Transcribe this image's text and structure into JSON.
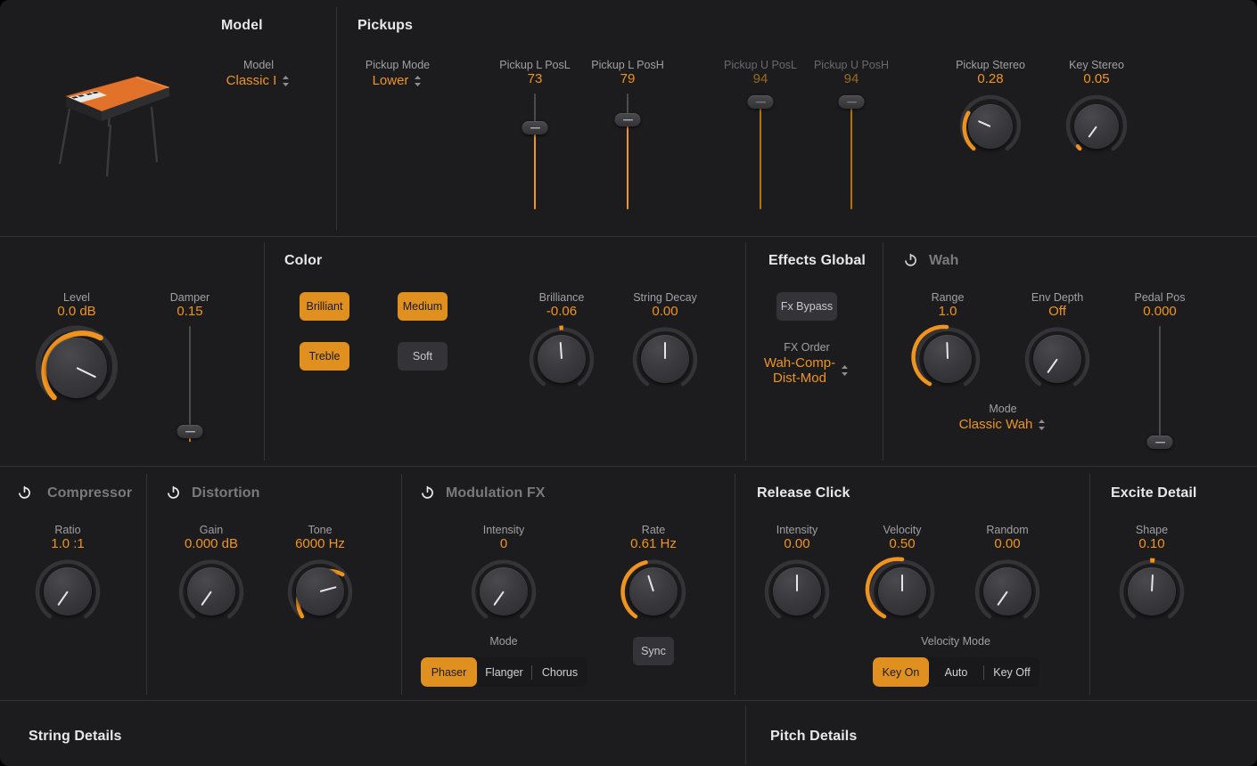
{
  "sections": {
    "model": {
      "title": "Model"
    },
    "pickups": {
      "title": "Pickups"
    },
    "color": {
      "title": "Color"
    },
    "effects_global": {
      "title": "Effects Global"
    },
    "wah": {
      "title": "Wah",
      "power_icon": "power-icon",
      "enabled": false
    },
    "compressor": {
      "title": "Compressor",
      "power_icon": "power-icon",
      "enabled": false
    },
    "distortion": {
      "title": "Distortion",
      "power_icon": "power-icon",
      "enabled": false
    },
    "modulation_fx": {
      "title": "Modulation FX",
      "power_icon": "power-icon",
      "enabled": false
    },
    "release_click": {
      "title": "Release Click"
    },
    "excite_detail": {
      "title": "Excite Detail"
    },
    "string_details": {
      "title": "String Details"
    },
    "pitch_details": {
      "title": "Pitch Details"
    }
  },
  "instrument_image": {
    "name": "electric-piano-illustration"
  },
  "model": {
    "label": "Model",
    "value": "Classic I",
    "chevron_icon": "chevron-up-down-icon"
  },
  "pickup_mode": {
    "label": "Pickup Mode",
    "value": "Lower",
    "chevron_icon": "chevron-up-down-icon"
  },
  "pickup_sliders": [
    {
      "label": "Pickup L PosL",
      "value": "73",
      "enabled": true,
      "pos": 0.27
    },
    {
      "label": "Pickup L PosH",
      "value": "79",
      "enabled": true,
      "pos": 0.21
    },
    {
      "label": "Pickup U PosL",
      "value": "94",
      "enabled": false,
      "pos": 0.06
    },
    {
      "label": "Pickup U PosH",
      "value": "94",
      "enabled": false,
      "pos": 0.06
    }
  ],
  "pickup_stereo": {
    "label": "Pickup Stereo",
    "value": "0.28",
    "arc": 0.28
  },
  "key_stereo": {
    "label": "Key Stereo",
    "value": "0.05",
    "arc": 0.05
  },
  "level": {
    "label": "Level",
    "value": "0.0 dB",
    "arc": 0.8
  },
  "damper": {
    "label": "Damper",
    "value": "0.15",
    "pos": 0.86
  },
  "color_buttons": [
    {
      "label": "Brilliant",
      "active": true
    },
    {
      "label": "Medium",
      "active": true
    },
    {
      "label": "Treble",
      "active": true
    },
    {
      "label": "Soft",
      "active": false
    }
  ],
  "brilliance": {
    "label": "Brilliance",
    "value": "-0.06",
    "arc": 0.47,
    "bipolar": true
  },
  "string_decay": {
    "label": "String Decay",
    "value": "0.00",
    "arc": 0.5,
    "bipolar": true
  },
  "fx_bypass": {
    "label": "Fx Bypass",
    "active": false
  },
  "fx_order": {
    "label": "FX Order",
    "value_line1": "Wah-Comp-",
    "value_line2": "Dist-Mod",
    "chevron_icon": "chevron-up-down-icon"
  },
  "wah_range": {
    "label": "Range",
    "value": "1.0",
    "arc": 1.0
  },
  "wah_env_depth": {
    "label": "Env Depth",
    "value": "Off",
    "arc": 0.0
  },
  "wah_pedal_pos": {
    "label": "Pedal Pos",
    "value": "0.000",
    "pos": 1.0
  },
  "wah_mode": {
    "label": "Mode",
    "value": "Classic Wah",
    "chevron_icon": "chevron-up-down-icon"
  },
  "comp_ratio": {
    "label": "Ratio",
    "value": "1.0 :1",
    "arc": 0.0
  },
  "dist_gain": {
    "label": "Gain",
    "value": "0.000 dB",
    "arc": 0.0
  },
  "dist_tone": {
    "label": "Tone",
    "value": "6000 Hz",
    "arc": 0.72
  },
  "mod_intensity": {
    "label": "Intensity",
    "value": "0",
    "arc": 0.0
  },
  "mod_rate": {
    "label": "Rate",
    "value": "0.61 Hz",
    "arc": 0.6
  },
  "mod_mode": {
    "label": "Mode",
    "options": [
      "Phaser",
      "Flanger",
      "Chorus"
    ],
    "selected": "Phaser"
  },
  "sync_button": {
    "label": "Sync",
    "active": false
  },
  "rc_intensity": {
    "label": "Intensity",
    "value": "0.00",
    "arc": 0.5,
    "bipolar": true
  },
  "rc_velocity": {
    "label": "Velocity",
    "value": "0.50",
    "arc": 0.5,
    "bipolar": true
  },
  "rc_random": {
    "label": "Random",
    "value": "0.00",
    "arc": 0.0
  },
  "velocity_mode": {
    "label": "Velocity Mode",
    "options": [
      "Key On",
      "Auto",
      "Key Off"
    ],
    "selected": "Key On"
  },
  "excite_shape": {
    "label": "Shape",
    "value": "0.10",
    "arc": 0.52,
    "bipolar": true
  },
  "colors": {
    "accent": "#f0941e",
    "accent_button": "#e0901f",
    "background": "#1c1c1e",
    "panel": "#202023",
    "divider": "#343437",
    "label": "#a0a0a4",
    "title": "#e8e8ea",
    "title_off": "#7a7a7e"
  }
}
